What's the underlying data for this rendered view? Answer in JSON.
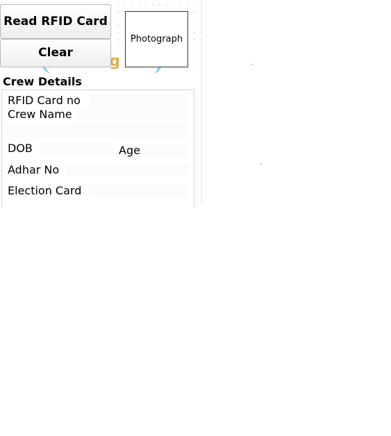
{
  "buttons": {
    "read_rfid": "Read RFID Card",
    "clear": "Clear"
  },
  "photo": {
    "label": "Photograph"
  },
  "logo": {
    "text": "essing"
  },
  "crew": {
    "title": "Crew Details",
    "fields": {
      "rfid_card_no": {
        "label": "RFID Card no",
        "value": ""
      },
      "crew_name": {
        "label": "Crew Name",
        "value": ""
      },
      "dob": {
        "label": "DOB",
        "value": ""
      },
      "age": {
        "label": "Age",
        "value": ""
      },
      "adhar_no": {
        "label": "Adhar No",
        "value": ""
      },
      "election_card": {
        "label": "Election Card",
        "value": ""
      }
    }
  },
  "colors": {
    "logo_blue": "#5cc2e6",
    "logo_gold": "#d7a22a"
  }
}
